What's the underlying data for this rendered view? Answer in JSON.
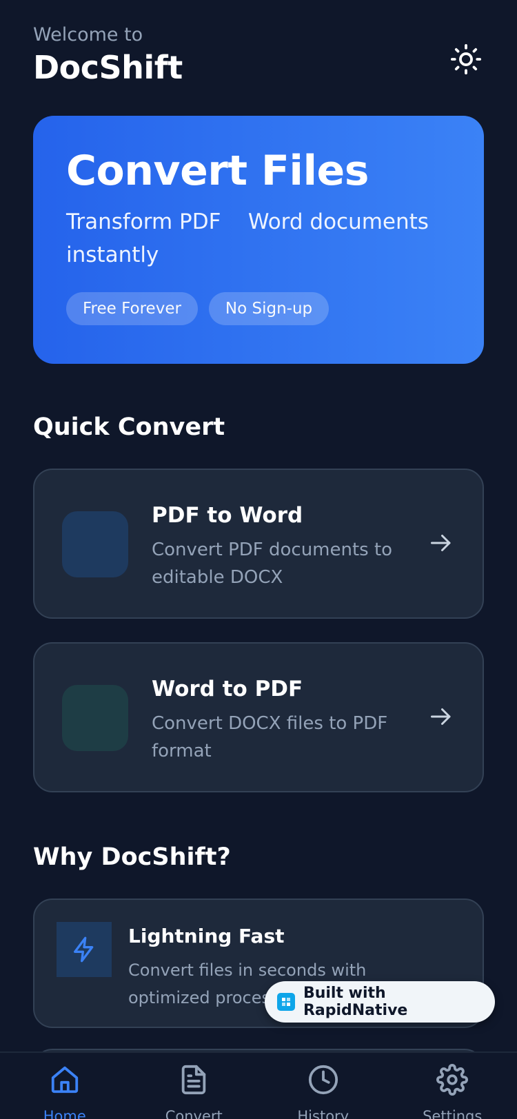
{
  "header": {
    "welcome": "Welcome to",
    "title": "DocShift",
    "theme_icon": "sun-icon"
  },
  "hero": {
    "title": "Convert Files",
    "subtitle": "Transform PDF    Word documents instantly",
    "badges": [
      "Free Forever",
      "No Sign-up"
    ]
  },
  "quick_convert": {
    "title": "Quick Convert",
    "cards": [
      {
        "title": "PDF to Word",
        "description": "Convert PDF documents to editable DOCX",
        "icon_color": "#1e3a5f",
        "arrow_icon": "arrow-right-icon"
      },
      {
        "title": "Word to PDF",
        "description": "Convert DOCX files to PDF format",
        "icon_color": "#1e3d45",
        "arrow_icon": "arrow-right-icon"
      }
    ]
  },
  "why": {
    "title": "Why DocShift?",
    "features": [
      {
        "title": "Lightning Fast",
        "description": "Convert files in seconds with optimized processing",
        "icon": "lightning-icon"
      }
    ]
  },
  "built_with": {
    "label": "Built with RapidNative"
  },
  "tabbar": {
    "active": "Home",
    "tabs": [
      {
        "label": "Home",
        "icon": "home-icon"
      },
      {
        "label": "Convert",
        "icon": "document-icon"
      },
      {
        "label": "History",
        "icon": "clock-icon"
      },
      {
        "label": "Settings",
        "icon": "gear-icon"
      }
    ]
  },
  "colors": {
    "background": "#0f172a",
    "card": "#1e293b",
    "accent": "#3b82f6",
    "muted_text": "#94a3b8"
  }
}
